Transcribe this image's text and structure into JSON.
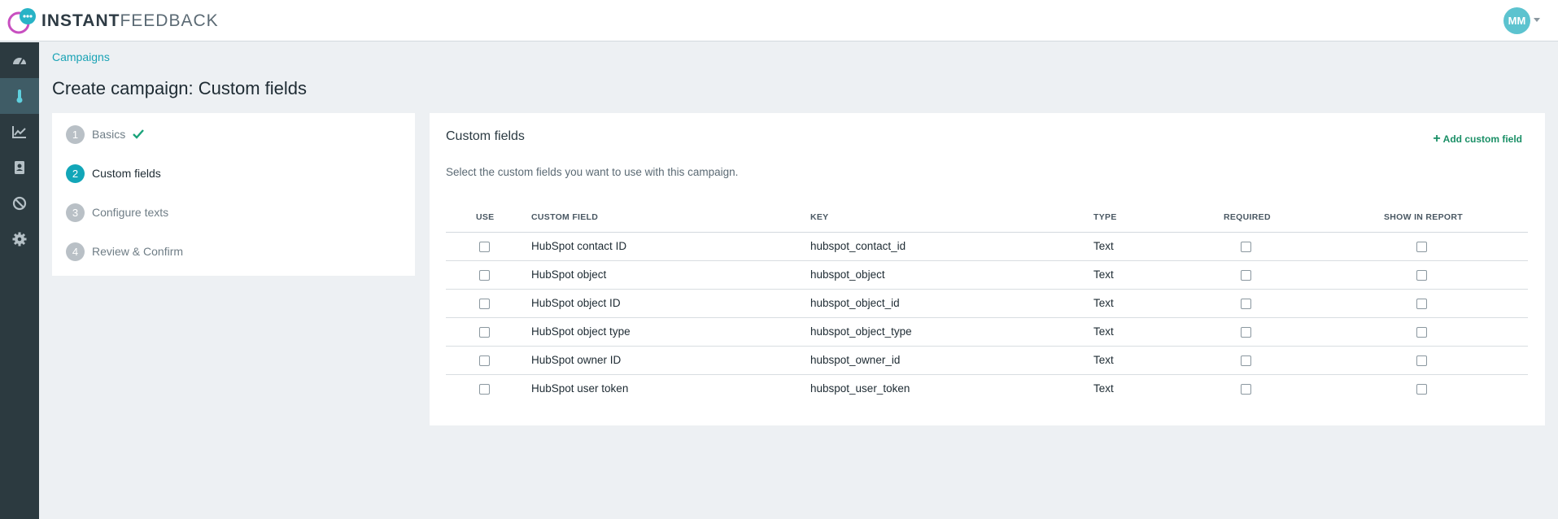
{
  "app": {
    "logo_text_strong": "INSTANT",
    "logo_text_light": "FEEDBACK",
    "user_initials": "MM"
  },
  "colors": {
    "accent": "#12a6b8",
    "sidebar_bg": "#2c3a40",
    "sidebar_active": "#3f5c66",
    "add_link": "#1a8f66",
    "avatar": "#5cc3cf"
  },
  "sidebar": {
    "items": [
      {
        "icon": "dashboard-icon",
        "active": false
      },
      {
        "icon": "thermometer-icon",
        "active": true
      },
      {
        "icon": "trending-chart-icon",
        "active": false
      },
      {
        "icon": "contacts-book-icon",
        "active": false
      },
      {
        "icon": "block-icon",
        "active": false
      },
      {
        "icon": "gear-icon",
        "active": false
      }
    ]
  },
  "breadcrumb": "Campaigns",
  "page_title": "Create campaign: Custom fields",
  "steps": [
    {
      "num": "1",
      "label": "Basics",
      "state": "done"
    },
    {
      "num": "2",
      "label": "Custom fields",
      "state": "active"
    },
    {
      "num": "3",
      "label": "Configure texts",
      "state": "pending"
    },
    {
      "num": "4",
      "label": "Review & Confirm",
      "state": "pending"
    }
  ],
  "fields_card": {
    "title": "Custom fields",
    "add_label": "Add custom field",
    "description": "Select the custom fields you want to use with this campaign.",
    "columns": {
      "use": "USE",
      "custom_field": "CUSTOM FIELD",
      "key": "KEY",
      "type": "TYPE",
      "required": "REQUIRED",
      "show_in_report": "SHOW IN REPORT"
    },
    "rows": [
      {
        "name": "HubSpot contact ID",
        "key": "hubspot_contact_id",
        "type": "Text",
        "use": false,
        "required": false,
        "show": false
      },
      {
        "name": "HubSpot object",
        "key": "hubspot_object",
        "type": "Text",
        "use": false,
        "required": false,
        "show": false
      },
      {
        "name": "HubSpot object ID",
        "key": "hubspot_object_id",
        "type": "Text",
        "use": false,
        "required": false,
        "show": false
      },
      {
        "name": "HubSpot object type",
        "key": "hubspot_object_type",
        "type": "Text",
        "use": false,
        "required": false,
        "show": false
      },
      {
        "name": "HubSpot owner ID",
        "key": "hubspot_owner_id",
        "type": "Text",
        "use": false,
        "required": false,
        "show": false
      },
      {
        "name": "HubSpot user token",
        "key": "hubspot_user_token",
        "type": "Text",
        "use": false,
        "required": false,
        "show": false
      }
    ]
  }
}
